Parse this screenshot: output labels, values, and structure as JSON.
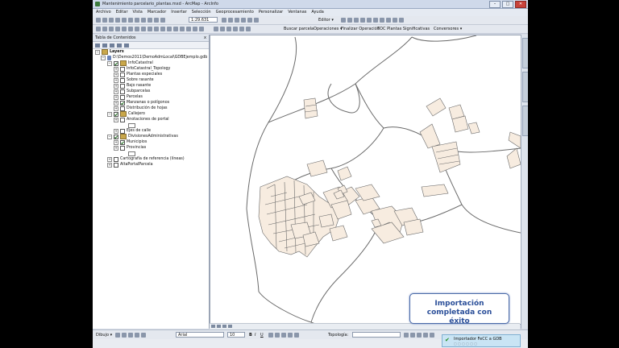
{
  "window": {
    "title": "Mantenimiento parcelario_plantas.mxd - ArcMap - ArcInfo",
    "controls": [
      "–",
      "□",
      "✕"
    ]
  },
  "menu": [
    "Archivo",
    "Editar",
    "Vista",
    "Marcador",
    "Insertar",
    "Selección",
    "Geoprocesamiento",
    "Personalizar",
    "Ventanas",
    "Ayuda"
  ],
  "toolbar": {
    "scale": "1:29.631",
    "editor_label": "Editor ▾",
    "buscar_parcela": "Buscar parcela",
    "operaciones": "Operaciones ▾",
    "finalizar": "Finalizar Operación",
    "toc_plantas": "TOC Plantas Significativas",
    "conversores": "Conversores ▾"
  },
  "toc": {
    "title": "Tabla de Contenidos",
    "close": "x",
    "layers_label": "Layers",
    "gdb_path": "D:\\Demos2011\\DemoAdmLocal\\GDBEjemplo.gdb",
    "items": [
      {
        "label": "InfoCatastral",
        "level": 1,
        "checked": true,
        "group": true
      },
      {
        "label": "InfoCatastral_Topology",
        "level": 2,
        "checked": false
      },
      {
        "label": "Plantas especiales",
        "level": 2,
        "checked": false
      },
      {
        "label": "Sobre rasante",
        "level": 2,
        "checked": false
      },
      {
        "label": "Bajo rasante",
        "level": 2,
        "checked": false
      },
      {
        "label": "Subparcelas",
        "level": 2,
        "checked": false
      },
      {
        "label": "Parcelas",
        "level": 2,
        "checked": false
      },
      {
        "label": "Manzanas o polígonos",
        "level": 2,
        "checked": true
      },
      {
        "label": "Distribución de hojas",
        "level": 2,
        "checked": false
      },
      {
        "label": "Callejero",
        "level": 1,
        "checked": true,
        "group": true
      },
      {
        "label": "Anotaciones de portal",
        "level": 2,
        "checked": false
      },
      {
        "label": "Ejes de calle",
        "level": 2,
        "checked": false
      },
      {
        "label": "DivisionesAdministrativas",
        "level": 1,
        "checked": true,
        "group": true
      },
      {
        "label": "Municipios",
        "level": 2,
        "checked": true
      },
      {
        "label": "Provincias",
        "level": 2,
        "checked": false
      },
      {
        "label": "Cartografía de referencia (líneas)",
        "level": 1,
        "checked": false
      },
      {
        "label": "AltaPortalParcela",
        "level": 1,
        "checked": false
      }
    ]
  },
  "drawing": {
    "dibujo": "Dibujo ▾",
    "font": "Arial",
    "size": "10",
    "bold": "B",
    "italic": "I",
    "underline": "U",
    "topologia": "Topología:"
  },
  "callout": {
    "line1": "Importación completada con",
    "line2": "éxito"
  },
  "notification": {
    "title": "Importador FeCC a GDB",
    "subtitle": "▢ ▢ ▢ ▢ ▢ ▢"
  },
  "colors": {
    "parcel_fill": "#f7ece0",
    "parcel_stroke": "#6a6a6a",
    "callout_text": "#2b4f99",
    "check": "#1e8c1e"
  }
}
